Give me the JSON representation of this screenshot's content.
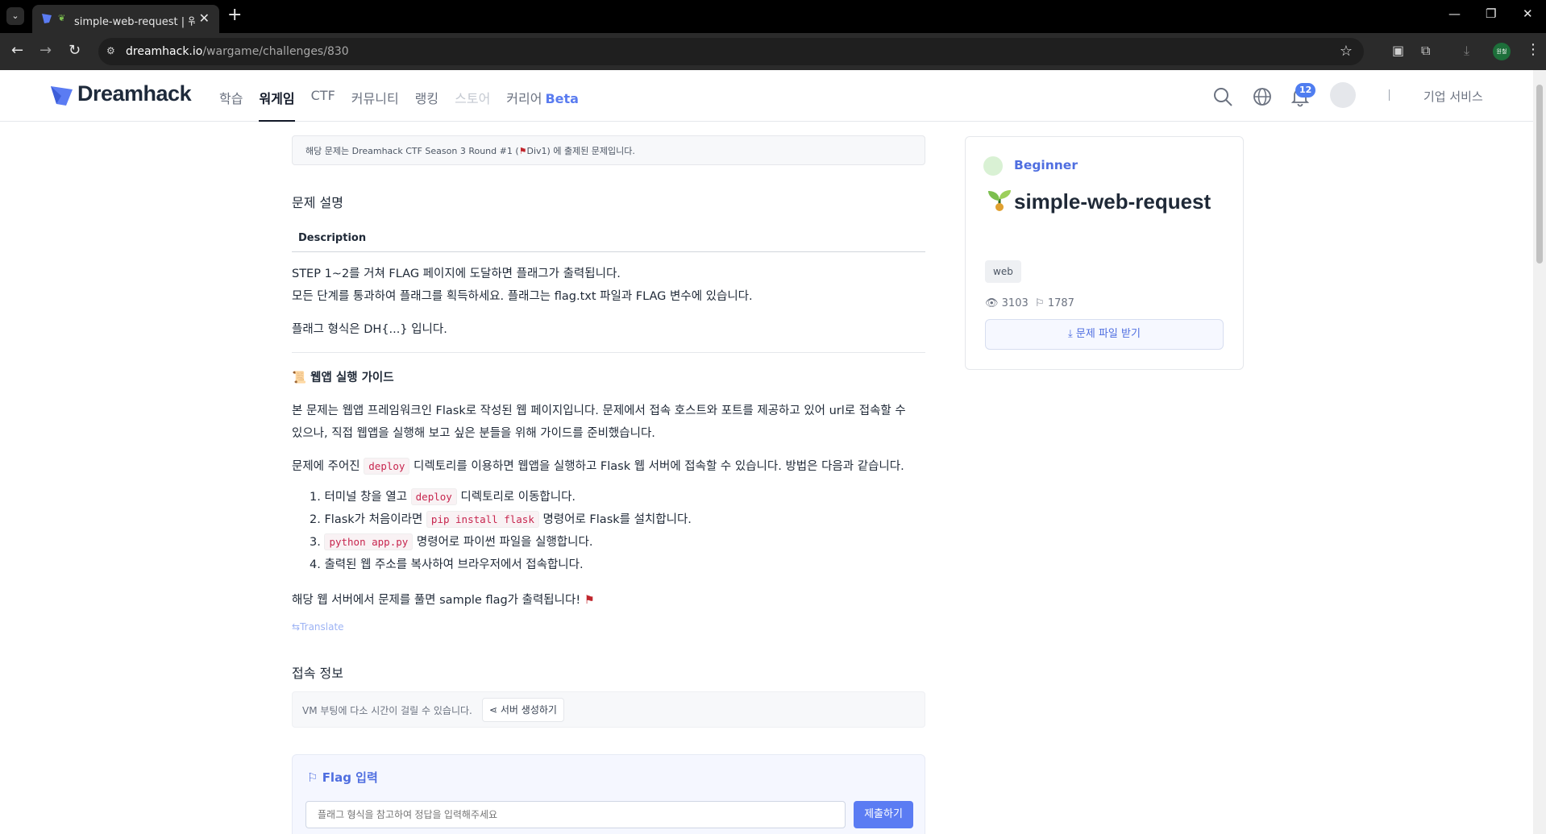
{
  "browser": {
    "tab_title": "simple-web-request | 워게",
    "url_host": "dreamhack.io",
    "url_path": "/wargame/challenges/830",
    "profile_label": "원철",
    "tab_list_icon": "chevron-down-icon"
  },
  "site": {
    "logo_text": "Dreamhack",
    "nav": {
      "learn": "학습",
      "wargame": "워게임",
      "ctf": "CTF",
      "community": "커뮤니티",
      "ranking": "랭킹",
      "store": "스토어",
      "career": "커리어",
      "beta": "Beta"
    },
    "notification_count": "12",
    "corporate": "기업 서비스",
    "accent_color": "#5b7cf3"
  },
  "notice": {
    "prefix": "해당 문제는 Dreamhack CTF Season 3 Round #1 (",
    "suffix": "Div1) 에 출제된 문제입니다."
  },
  "problem": {
    "section_title": "문제 설명",
    "desc_tab": "Description",
    "line1": "STEP 1~2를 거쳐 FLAG 페이지에 도달하면 플래그가 출력됩니다.",
    "line2": "모든 단계를 통과하여 플래그를 획득하세요. 플래그는 flag.txt 파일과 FLAG 변수에 있습니다.",
    "line3": "플래그 형식은 DH{...} 입니다.",
    "guide_title": "웹앱 실행 가이드",
    "guide_p1a": "본 문제는 웹앱 프레임워크인 Flask로 작성된 웹 페이지입니다. 문제에서 접속 호스트와 포트를 제공하고 있어 url로 접속할 수",
    "guide_p1b": "있으나, 직접 웹앱을 실행해 보고 싶은 분들을 위해 가이드를 준비했습니다.",
    "guide_p2_pre": "문제에 주어진 ",
    "guide_p2_code": "deploy",
    "guide_p2_post": " 디렉토리를 이용하면 웹앱을 실행하고 Flask 웹 서버에 접속할 수 있습니다. 방법은 다음과 같습니다.",
    "steps": {
      "s1_pre": "1. 터미널 창을 열고 ",
      "s1_code": "deploy",
      "s1_post": " 디렉토리로 이동합니다.",
      "s2_pre": "2. Flask가 처음이라면 ",
      "s2_code": "pip install flask",
      "s2_post": " 명령어로 Flask를 설치합니다.",
      "s3_pre": "3. ",
      "s3_code": "python app.py",
      "s3_post": " 명령어로 파이썬 파일을 실행합니다.",
      "s4": "4. 출력된 웹 주소를 복사하여 브라우저에서 접속합니다."
    },
    "closing": "해당 웹 서버에서 문제를 풀면 sample flag가 출력됩니다!",
    "translate": "Translate"
  },
  "access": {
    "title": "접속 정보",
    "vm_text": "VM 부팅에 다소 시간이 걸릴 수 있습니다.",
    "create_server": "서버 생성하기"
  },
  "flag": {
    "title": "Flag 입력",
    "placeholder": "플래그 형식을 참고하여 정답을 입력해주세요",
    "submit": "제출하기"
  },
  "card": {
    "level": "Beginner",
    "title": "simple-web-request",
    "tag": "web",
    "views": "3103",
    "solves": "1787",
    "download": "문제 파일 받기"
  }
}
